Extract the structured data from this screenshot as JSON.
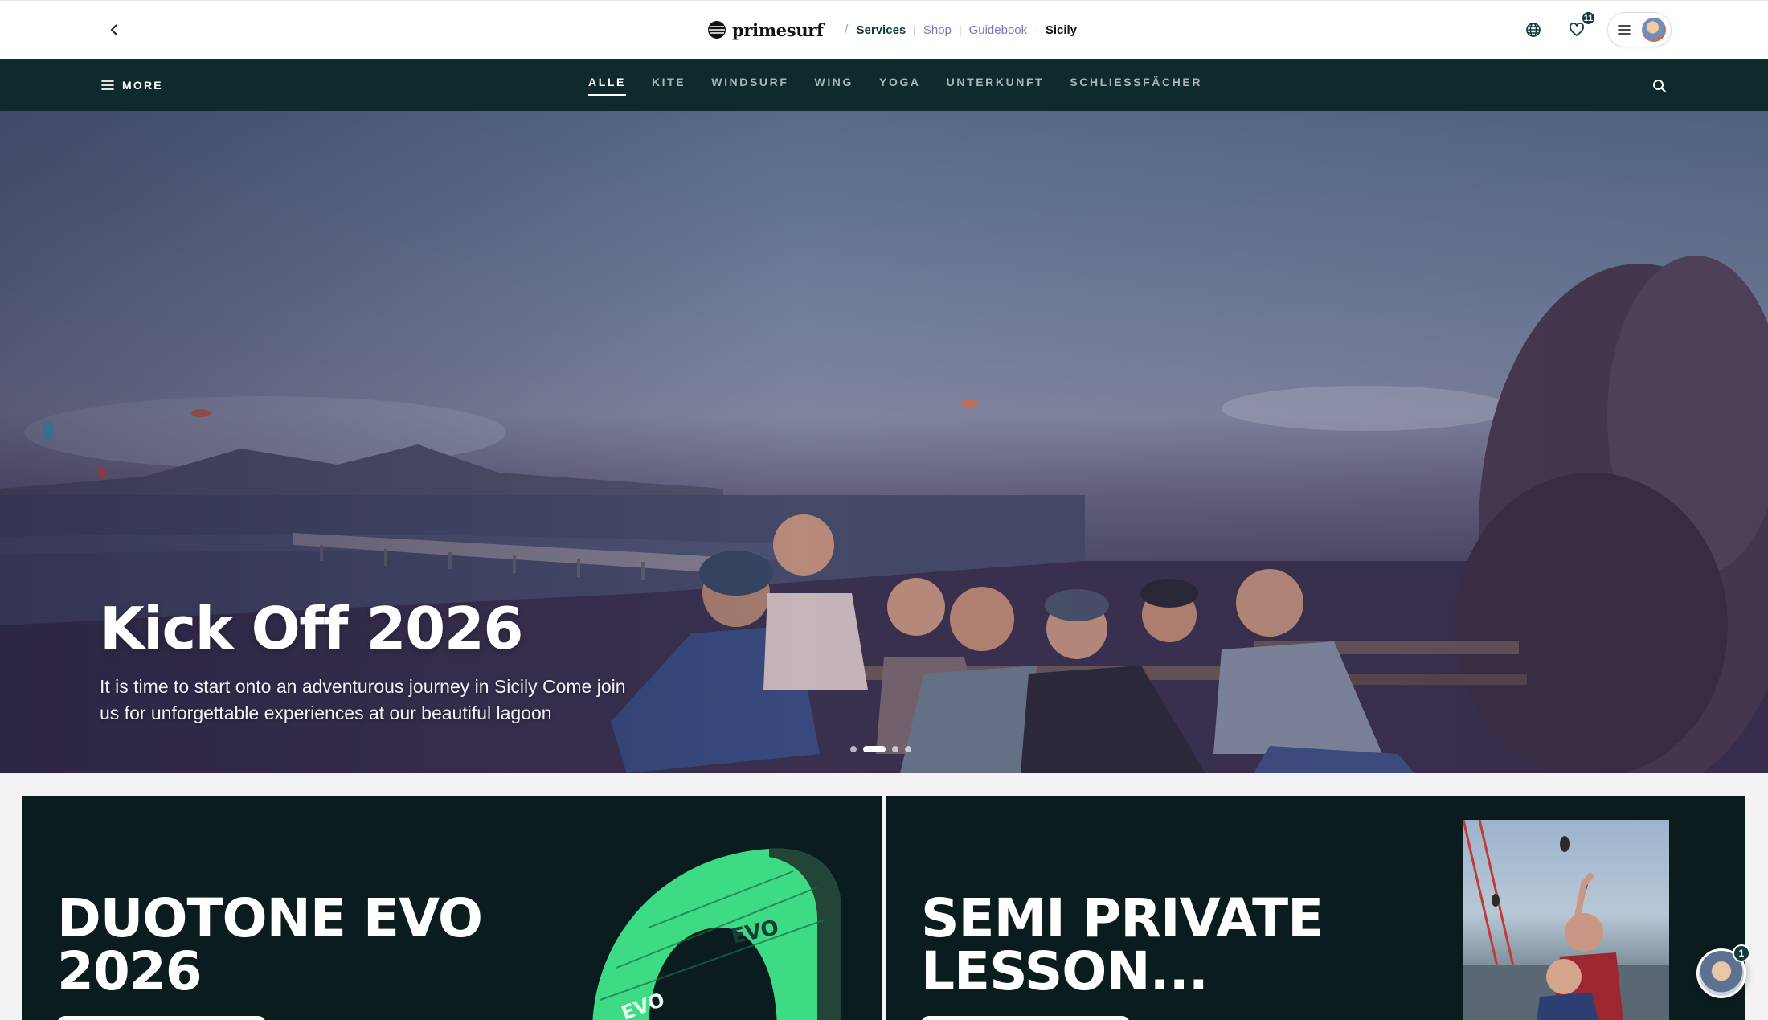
{
  "header": {
    "brand": "primesurf",
    "breadcrumbs": [
      {
        "label": "Services"
      },
      {
        "label": "Shop"
      },
      {
        "label": "Guidebook"
      },
      {
        "label": "Sicily"
      }
    ],
    "favorites_count": "11"
  },
  "nav": {
    "more_label": "MORE",
    "tabs": [
      {
        "label": "ALLE",
        "active": true
      },
      {
        "label": "KITE"
      },
      {
        "label": "WINDSURF"
      },
      {
        "label": "WING"
      },
      {
        "label": "YOGA"
      },
      {
        "label": "UNTERKUNFT"
      },
      {
        "label": "SCHLIESSFÄCHER"
      }
    ]
  },
  "hero": {
    "title": "Kick Off 2026",
    "subtitle": "It is time to start onto an adventurous journey in Sicily Come join us for unforgettable experiences at our beautiful lagoon",
    "slides_total": 4,
    "active_slide": 2
  },
  "cards": [
    {
      "title": "DUOTONE EVO\n2026"
    },
    {
      "title": "SEMI PRIVATE\nLESSON..."
    }
  ],
  "chat": {
    "unread": "1"
  },
  "colors": {
    "nav_bg": "#0f2a2c",
    "accent": "#0f3a40",
    "link": "#7c74b8",
    "card_bg": "#0b1c1f",
    "kite_green": "#3ddc84"
  },
  "icons": {
    "back": "chevron-left-icon",
    "language": "globe-icon",
    "favorites": "heart-icon",
    "menu": "hamburger-icon",
    "search": "search-icon"
  }
}
